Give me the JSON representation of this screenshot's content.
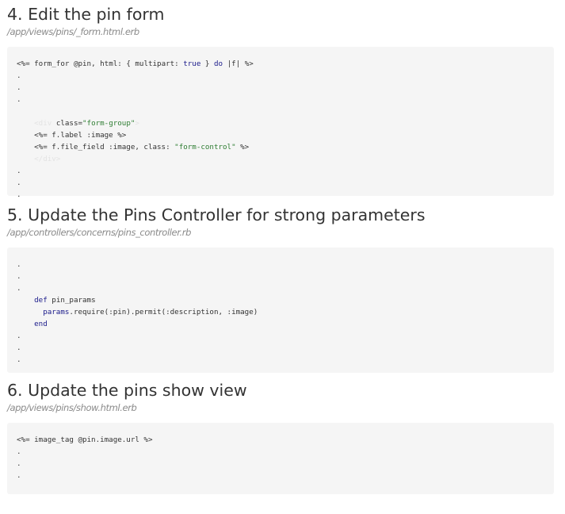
{
  "sections": [
    {
      "title": "4. Edit the pin form",
      "path": "/app/views/pins/_form.html.erb",
      "lines": [
        {
          "indent": "",
          "parts": [
            {
              "t": "<%= ",
              "c": "sym"
            },
            {
              "t": "form_for",
              "c": "sym"
            },
            {
              "t": " @pin, html: { multipart: ",
              "c": "sym"
            },
            {
              "t": "true",
              "c": "kw"
            },
            {
              "t": " } ",
              "c": "sym"
            },
            {
              "t": "do",
              "c": "kw"
            },
            {
              "t": " |f| %>",
              "c": "sym"
            }
          ]
        },
        {
          "indent": "",
          "parts": [
            {
              "t": ".",
              "c": "sym"
            }
          ]
        },
        {
          "indent": "",
          "parts": [
            {
              "t": ".",
              "c": "sym"
            }
          ]
        },
        {
          "indent": "",
          "parts": [
            {
              "t": ".",
              "c": "sym"
            }
          ]
        },
        {
          "indent": "",
          "parts": []
        },
        {
          "indent": "    ",
          "parts": [
            {
              "t": "<div ",
              "c": "faint"
            },
            {
              "t": "class=",
              "c": "sym"
            },
            {
              "t": "\"form-group\"",
              "c": "str"
            },
            {
              "t": ">",
              "c": "faint"
            }
          ]
        },
        {
          "indent": "    ",
          "parts": [
            {
              "t": "<%= f.label :image %>",
              "c": "sym"
            }
          ]
        },
        {
          "indent": "    ",
          "parts": [
            {
              "t": "<%= f.file_field :image, class: ",
              "c": "sym"
            },
            {
              "t": "\"form-control\"",
              "c": "str"
            },
            {
              "t": " %>",
              "c": "sym"
            }
          ]
        },
        {
          "indent": "    ",
          "parts": [
            {
              "t": "</div>",
              "c": "faint"
            }
          ]
        },
        {
          "indent": "",
          "parts": [
            {
              "t": ".",
              "c": "sym"
            }
          ]
        },
        {
          "indent": "",
          "parts": [
            {
              "t": ".",
              "c": "sym"
            }
          ]
        },
        {
          "indent": "",
          "parts": [
            {
              "t": ".",
              "c": "sym"
            }
          ]
        }
      ]
    },
    {
      "title": "5. Update the Pins Controller for strong parameters",
      "path": "/app/controllers/concerns/pins_controller.rb",
      "lines": [
        {
          "indent": "",
          "parts": [
            {
              "t": ".",
              "c": "sym"
            }
          ]
        },
        {
          "indent": "",
          "parts": [
            {
              "t": ".",
              "c": "sym"
            }
          ]
        },
        {
          "indent": "",
          "parts": [
            {
              "t": ".",
              "c": "sym"
            }
          ]
        },
        {
          "indent": "    ",
          "parts": [
            {
              "t": "def",
              "c": "kw"
            },
            {
              "t": " pin_params",
              "c": "sym"
            }
          ]
        },
        {
          "indent": "      ",
          "parts": [
            {
              "t": "params",
              "c": "kw"
            },
            {
              "t": ".require(:pin).permit(:description, :image)",
              "c": "sym"
            }
          ]
        },
        {
          "indent": "    ",
          "parts": [
            {
              "t": "end",
              "c": "kw"
            }
          ]
        },
        {
          "indent": "",
          "parts": [
            {
              "t": ".",
              "c": "sym"
            }
          ]
        },
        {
          "indent": "",
          "parts": [
            {
              "t": ".",
              "c": "sym"
            }
          ]
        },
        {
          "indent": "",
          "parts": [
            {
              "t": ".",
              "c": "sym"
            }
          ]
        }
      ]
    },
    {
      "title": "6. Update the pins show view",
      "path": "/app/views/pins/show.html.erb",
      "lines": [
        {
          "indent": "",
          "parts": [
            {
              "t": "<%= image_tag @pin.image.url %>",
              "c": "sym"
            }
          ]
        },
        {
          "indent": "",
          "parts": [
            {
              "t": ".",
              "c": "sym"
            }
          ]
        },
        {
          "indent": "",
          "parts": [
            {
              "t": ".",
              "c": "sym"
            }
          ]
        },
        {
          "indent": "",
          "parts": [
            {
              "t": ".",
              "c": "sym"
            }
          ]
        }
      ]
    }
  ]
}
